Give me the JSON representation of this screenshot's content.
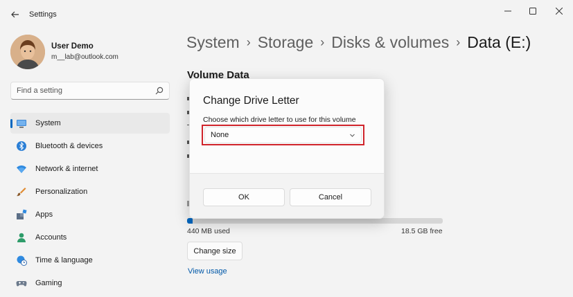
{
  "window": {
    "title": "Settings",
    "back_icon": "arrow-left-icon",
    "minimize_icon": "minimize-icon",
    "maximize_icon": "maximize-icon",
    "close_icon": "close-icon"
  },
  "profile": {
    "name": "User Demo",
    "email": "m__lab@outlook.com"
  },
  "search": {
    "placeholder": "Find a setting",
    "icon": "search-icon"
  },
  "sidebar": {
    "items": [
      {
        "label": "System",
        "icon": "display-icon",
        "active": true
      },
      {
        "label": "Bluetooth & devices",
        "icon": "bluetooth-icon",
        "active": false
      },
      {
        "label": "Network & internet",
        "icon": "wifi-icon",
        "active": false
      },
      {
        "label": "Personalization",
        "icon": "brush-icon",
        "active": false
      },
      {
        "label": "Apps",
        "icon": "apps-icon",
        "active": false
      },
      {
        "label": "Accounts",
        "icon": "person-icon",
        "active": false
      },
      {
        "label": "Time & language",
        "icon": "globe-clock-icon",
        "active": false
      },
      {
        "label": "Gaming",
        "icon": "gamepad-icon",
        "active": false
      }
    ]
  },
  "breadcrumb": {
    "items": [
      "System",
      "Storage",
      "Disks & volumes"
    ],
    "current": "Data (E:)",
    "separator": "›"
  },
  "main": {
    "section_title": "Volume Data",
    "storage": {
      "used_fraction": 0.023,
      "used_label": "440 MB used",
      "free_label": "18.5 GB free"
    },
    "change_size_label": "Change size",
    "view_usage_label": "View usage"
  },
  "dialog": {
    "title": "Change Drive Letter",
    "description": "Choose which drive letter to use for this volume",
    "selected_value": "None",
    "ok_label": "OK",
    "cancel_label": "Cancel"
  },
  "colors": {
    "accent": "#0067c0",
    "highlight": "#d0232a",
    "background": "#f3f3f3"
  }
}
